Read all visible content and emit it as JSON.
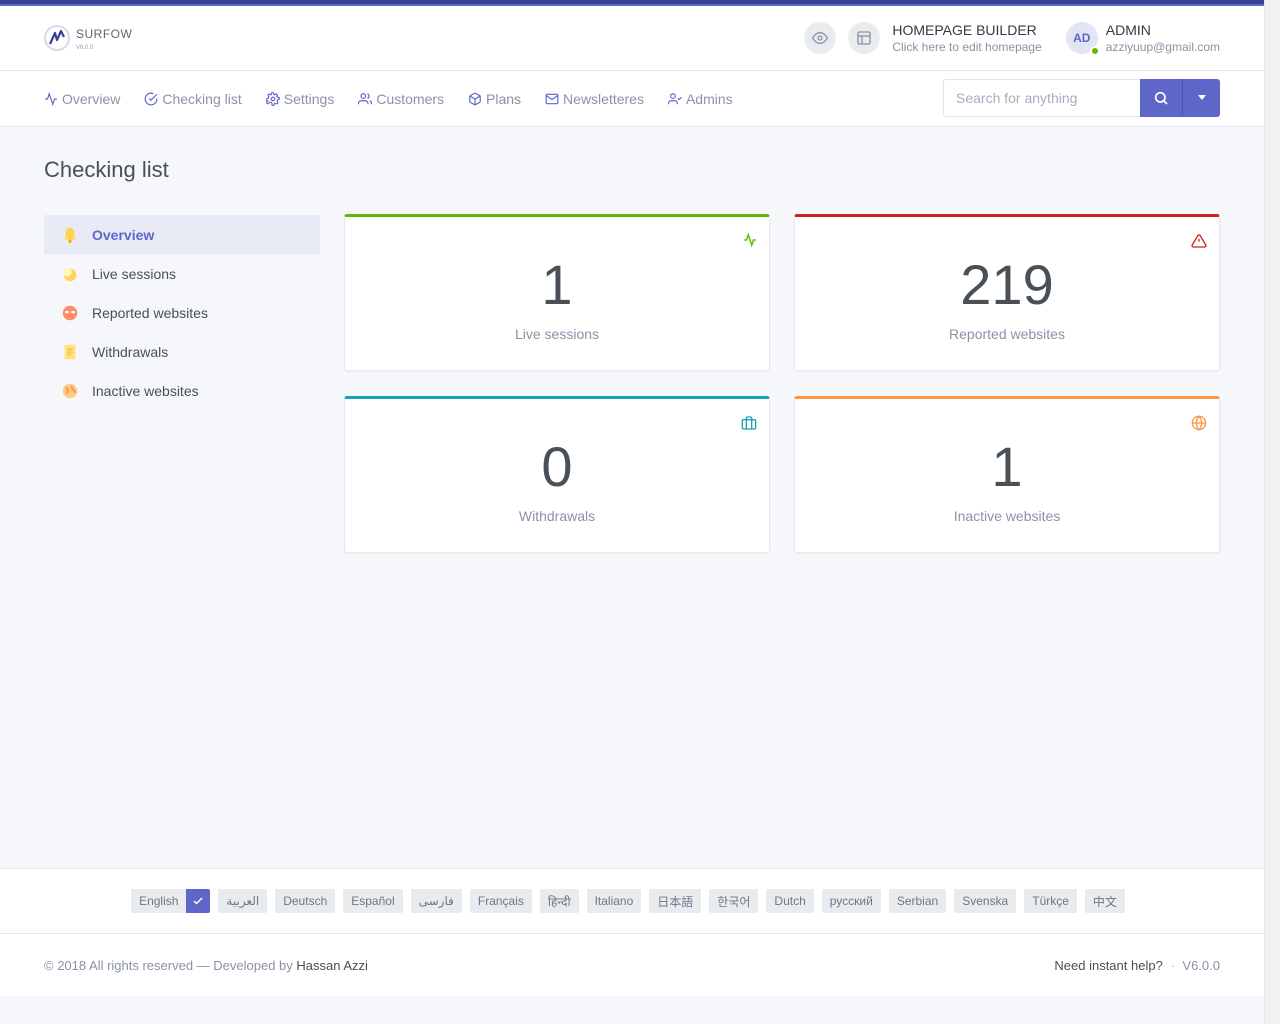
{
  "app": {
    "logo_text": "SURFOW",
    "logo_version": "V6.0.0"
  },
  "header": {
    "builder_title": "HOMEPAGE BUILDER",
    "builder_sub": "Click here to edit homepage",
    "avatar_initials": "AD",
    "admin_name": "ADMIN",
    "admin_email": "azziyuup@gmail.com"
  },
  "nav": {
    "items": [
      {
        "label": "Overview",
        "icon": "activity-icon"
      },
      {
        "label": "Checking list",
        "icon": "check-circle-icon"
      },
      {
        "label": "Settings",
        "icon": "gear-icon"
      },
      {
        "label": "Customers",
        "icon": "users-icon"
      },
      {
        "label": "Plans",
        "icon": "box-icon"
      },
      {
        "label": "Newsletteres",
        "icon": "mail-icon"
      },
      {
        "label": "Admins",
        "icon": "user-check-icon"
      }
    ],
    "search_placeholder": "Search for anything"
  },
  "page": {
    "title": "Checking list"
  },
  "sidemenu": {
    "items": [
      {
        "label": "Overview",
        "icon": "bell-icon",
        "active": true
      },
      {
        "label": "Live sessions",
        "icon": "moon-icon",
        "active": false
      },
      {
        "label": "Reported websites",
        "icon": "alien-icon",
        "active": false
      },
      {
        "label": "Withdrawals",
        "icon": "receipt-icon",
        "active": false
      },
      {
        "label": "Inactive websites",
        "icon": "globe-icon",
        "active": false
      }
    ]
  },
  "cards": [
    {
      "value": "1",
      "label": "Live sessions",
      "icon": "activity-icon",
      "color": "#5eba00"
    },
    {
      "value": "219",
      "label": "Reported websites",
      "icon": "alert-triangle-icon",
      "color": "#cd201f"
    },
    {
      "value": "0",
      "label": "Withdrawals",
      "icon": "briefcase-icon",
      "color": "#17a2b8"
    },
    {
      "value": "1",
      "label": "Inactive websites",
      "icon": "globe-icon",
      "color": "#fd9644"
    }
  ],
  "languages": {
    "items": [
      "English",
      "العربية",
      "Deutsch",
      "Español",
      "فارسی",
      "Français",
      "हिन्दी",
      "Italiano",
      "日本語",
      "한국어",
      "Dutch",
      "русский",
      "Serbian",
      "Svenska",
      "Türkçe",
      "中文"
    ],
    "selected": "English"
  },
  "footer": {
    "copyright": "© 2018 All rights reserved — Developed by",
    "developer": "Hassan Azzi",
    "help": "Need instant help?",
    "separator": "·",
    "version": "V6.0.0"
  },
  "colors": {
    "accent": "#5f66c9",
    "background": "#f5f7fb"
  }
}
